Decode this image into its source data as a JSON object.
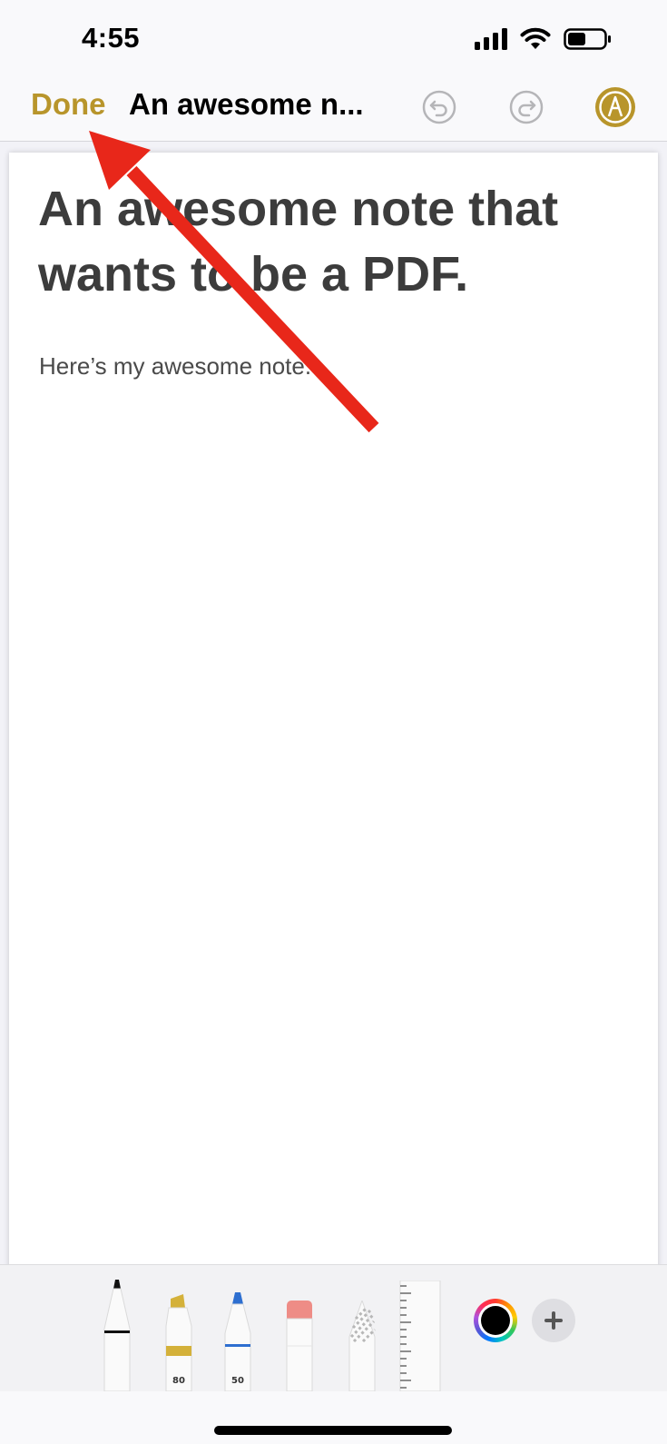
{
  "status_bar": {
    "time": "4:55",
    "icons": [
      "cellular-signal-icon",
      "wifi-icon",
      "battery-icon"
    ]
  },
  "nav": {
    "done_label": "Done",
    "title": "An awesome n...",
    "undo_icon": "undo-icon",
    "redo_icon": "redo-icon",
    "markup_icon": "markup-pen-icon",
    "accent_color": "#b8952b"
  },
  "note": {
    "title": "An awesome note that wants to be a PDF.",
    "body": "Here’s my awesome note."
  },
  "annotation": {
    "arrow_color": "#e8271a",
    "points_to": "done-button"
  },
  "tool_palette": {
    "tools": [
      {
        "name": "pen",
        "selected": true
      },
      {
        "name": "highlighter",
        "width": "80",
        "color": "#d4b13a"
      },
      {
        "name": "pencil",
        "width": "50",
        "color": "#2e6fd0"
      },
      {
        "name": "eraser"
      },
      {
        "name": "lasso"
      },
      {
        "name": "ruler"
      }
    ],
    "current_color": "#000000"
  }
}
